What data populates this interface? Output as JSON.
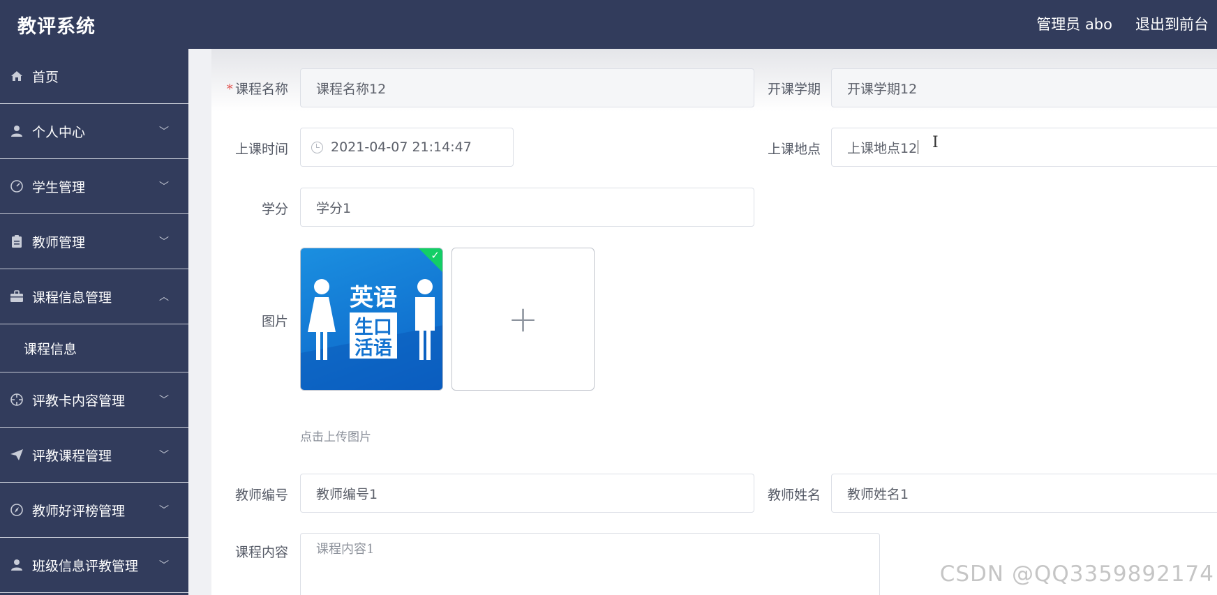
{
  "header": {
    "title": "教评系统",
    "user_label": "管理员 abo",
    "exit_label": "退出到前台"
  },
  "sidebar": {
    "items": [
      {
        "label": "首页",
        "icon": "home-icon"
      },
      {
        "label": "个人中心",
        "icon": "user-icon"
      },
      {
        "label": "学生管理",
        "icon": "dashboard-icon"
      },
      {
        "label": "教师管理",
        "icon": "clipboard-icon"
      },
      {
        "label": "课程信息管理",
        "icon": "briefcase-icon"
      },
      {
        "label": "评教卡内容管理",
        "icon": "crosshair-icon"
      },
      {
        "label": "评教课程管理",
        "icon": "send-icon"
      },
      {
        "label": "教师好评榜管理",
        "icon": "compass-icon"
      },
      {
        "label": "班级信息评教管理",
        "icon": "user-icon"
      }
    ],
    "submenu": {
      "label": "课程信息"
    }
  },
  "form": {
    "course_name": {
      "label": "课程名称",
      "required_mark": "*",
      "value": "课程名称12"
    },
    "semester": {
      "label": "开课学期",
      "value": "开课学期12"
    },
    "class_time": {
      "label": "上课时间",
      "value": "2021-04-07 21:14:47"
    },
    "location": {
      "label": "上课地点",
      "value": "上课地点12"
    },
    "credit": {
      "label": "学分",
      "value": "学分1"
    },
    "image": {
      "label": "图片",
      "upload_tip": "点击上传图片",
      "thumb_text_line1": "英语",
      "thumb_text_line2": "生口",
      "thumb_text_line3": "活语"
    },
    "teacher_id": {
      "label": "教师编号",
      "value": "教师编号1"
    },
    "teacher_name": {
      "label": "教师姓名",
      "value": "教师姓名1"
    },
    "content": {
      "label": "课程内容",
      "value": "课程内容1"
    }
  },
  "watermark": "CSDN @QQ3359892174",
  "colors": {
    "sidebar_bg": "#323c5c",
    "success_green": "#13ce66",
    "required_red": "#e2534f"
  }
}
